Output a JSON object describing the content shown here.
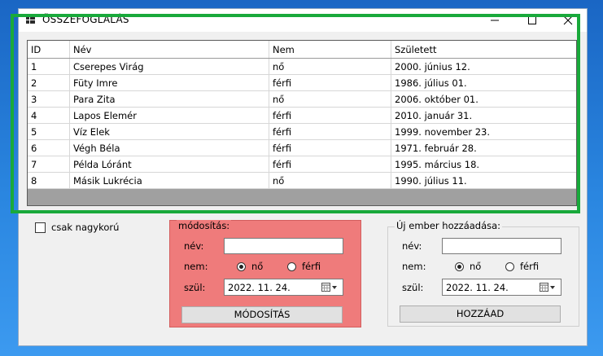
{
  "window": {
    "title": "ÖSSZEFOGLALÁS"
  },
  "table": {
    "columns": [
      "ID",
      "Név",
      "Nem",
      "Született"
    ],
    "rows": [
      [
        "1",
        "Cserepes Virág",
        "nő",
        "2000. június 12."
      ],
      [
        "2",
        "Füty Imre",
        "férfi",
        "1986. július 01."
      ],
      [
        "3",
        "Para Zita",
        "nő",
        "2006. október 01."
      ],
      [
        "4",
        "Lapos Elemér",
        "férfi",
        "2010. január 31."
      ],
      [
        "5",
        "Víz Elek",
        "férfi",
        "1999. november 23."
      ],
      [
        "6",
        "Végh Béla",
        "férfi",
        "1971. február 28."
      ],
      [
        "7",
        "Példa Lóránt",
        "férfi",
        "1995. március 18."
      ],
      [
        "8",
        "Másik Lukrécia",
        "nő",
        "1990. július 11."
      ]
    ]
  },
  "filter": {
    "label": "csak nagykorú",
    "checked": false
  },
  "edit": {
    "legend": "módosítás:",
    "name_label": "név:",
    "name_value": "",
    "gender_label": "nem:",
    "gender_female": "nő",
    "gender_male": "férfi",
    "gender_selected": "nő",
    "birth_label": "szül:",
    "birth_value": "2022. 11. 24.",
    "submit_label": "MÓDOSÍTÁS"
  },
  "add": {
    "legend": "Új ember hozzáadása:",
    "name_label": "név:",
    "name_value": "",
    "gender_label": "nem:",
    "gender_female": "nő",
    "gender_male": "férfi",
    "gender_selected": "nő",
    "birth_label": "szül:",
    "birth_value": "2022. 11. 24.",
    "submit_label": "HOZZÁAD"
  },
  "colors": {
    "edit_panel_bg": "#ef7b7b",
    "highlight_frame": "#19a93b",
    "window_bg": "#f0f0f0"
  },
  "icons": [
    "app-icon",
    "minimize-icon",
    "maximize-icon",
    "close-icon",
    "calendar-icon",
    "dropdown-arrow-icon"
  ]
}
